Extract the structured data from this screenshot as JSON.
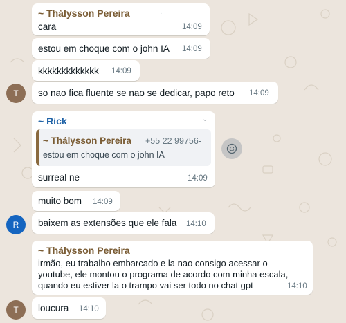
{
  "colors": {
    "sender_thalysson": "#7a5c34",
    "sender_rick": "#1f62a6",
    "avatar_t": "#8d6e55",
    "avatar_r": "#1565c0",
    "background": "#ece5dd"
  },
  "messages": [
    {
      "sender": "~ Thálysson Pereira",
      "text": "cara",
      "time": "14:09"
    },
    {
      "text": "estou em choque com o john IA",
      "time": "14:09"
    },
    {
      "text": "kkkkkkkkkkkkk",
      "time": "14:09"
    },
    {
      "avatar": "T",
      "text": "so nao fica fluente se nao se dedicar, papo reto",
      "time": "14:09"
    },
    {
      "sender": "~ Rick",
      "quote": {
        "sender": "~ Thálysson Pereira",
        "phone": "+55 22 99756-",
        "text": "estou em choque com o john IA"
      },
      "text": "surreal ne",
      "time": "14:09",
      "reaction_icon": "emoji-icon"
    },
    {
      "text": "muito bom",
      "time": "14:09"
    },
    {
      "avatar": "R",
      "text": "baixem as extensões que ele fala",
      "time": "14:10"
    },
    {
      "sender": "~ Thálysson Pereira",
      "lines": [
        "irmão, eu trabalho embarcado e la nao consigo acessar o",
        "youtube, ele montou o programa de acordo com minha escala,",
        "quando eu estiver la o trampo vai ser todo no chat gpt"
      ],
      "time": "14:10"
    },
    {
      "avatar": "T",
      "text": "loucura",
      "time": "14:10"
    }
  ]
}
